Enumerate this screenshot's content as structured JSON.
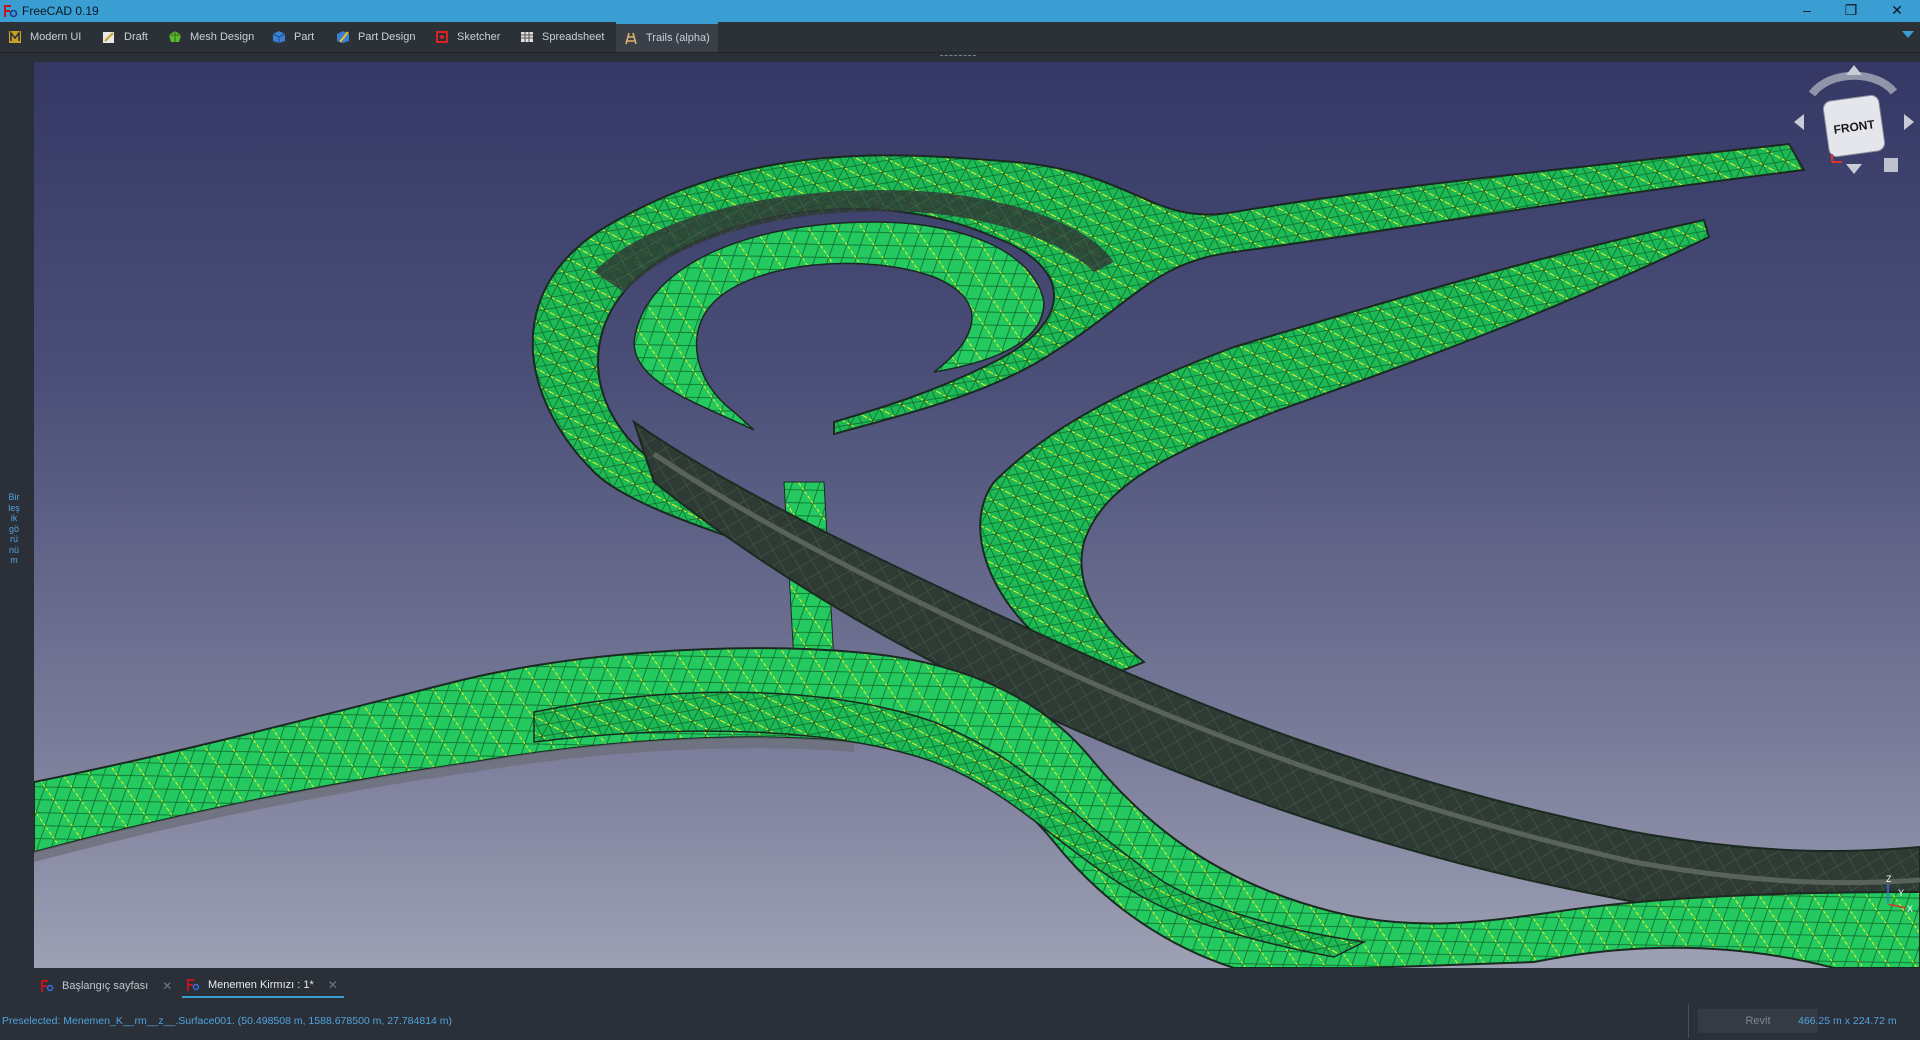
{
  "window": {
    "title": "FreeCAD 0.19",
    "minimize": "–",
    "maximize": "❐",
    "close": "✕"
  },
  "workbenches": [
    {
      "label": "Modern UI",
      "icon": "modern-ui-icon"
    },
    {
      "label": "Draft",
      "icon": "draft-icon"
    },
    {
      "label": "Mesh Design",
      "icon": "mesh-design-icon"
    },
    {
      "label": "Part",
      "icon": "part-icon"
    },
    {
      "label": "Part Design",
      "icon": "part-design-icon"
    },
    {
      "label": "Sketcher",
      "icon": "sketcher-icon"
    },
    {
      "label": "Spreadsheet",
      "icon": "spreadsheet-icon"
    },
    {
      "label": "Trails (alpha)",
      "icon": "trails-icon",
      "active": true
    }
  ],
  "side_panel": {
    "label": "Birleşik görünüm"
  },
  "navcube": {
    "face": "FRONT"
  },
  "axes": {
    "x": "X",
    "y": "Y",
    "z": "Z"
  },
  "document_tabs": [
    {
      "label": "Başlangıç sayfası",
      "active": false
    },
    {
      "label": "Menemen Kirmızı : 1*",
      "active": true
    }
  ],
  "status": {
    "message": "Preselected: Menemen_K__rm__z__.Surface001. (50.498508 m, 1588.678500 m, 27.784814 m)",
    "navigation_style": "Revit",
    "dimensions": "466.25 m x 224.72 m"
  },
  "colors": {
    "accent": "#3a9ed3",
    "surface_green": "#1ec85a",
    "surface_dark": "#2e3a34",
    "edge_yellow": "#f0f020",
    "status_text": "#4fa3e0"
  }
}
